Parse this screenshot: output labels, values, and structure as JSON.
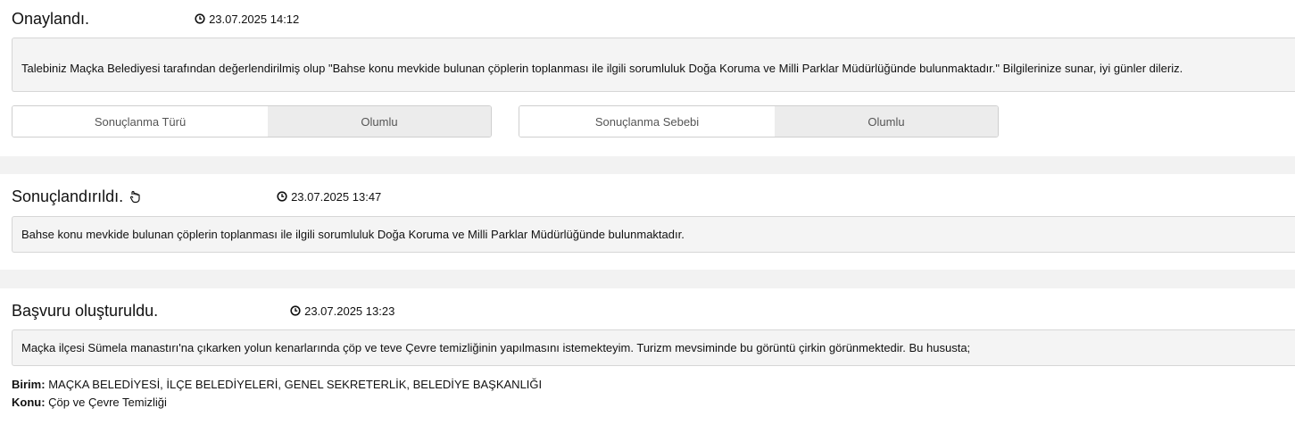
{
  "entries": [
    {
      "status": "Onaylandı.",
      "timestamp": "23.07.2025 14:12",
      "message": "Talebiniz Maçka Belediyesi tarafından değerlendirilmiş olup \"Bahse konu mevkide bulunan çöplerin toplanması ile ilgili sorumluluk Doğa Koruma ve Milli Parklar Müdürlüğünde bulunmaktadır.\" Bilgilerinize sunar, iyi günler dileriz.",
      "results": [
        {
          "label": "Sonuçlanma Türü",
          "value": "Olumlu"
        },
        {
          "label": "Sonuçlanma Sebebi",
          "value": "Olumlu"
        }
      ]
    },
    {
      "status": "Sonuçlandırıldı.",
      "timestamp": "23.07.2025 13:47",
      "message": "Bahse konu mevkide bulunan çöplerin toplanması ile ilgili sorumluluk Doğa Koruma ve Milli Parklar Müdürlüğünde bulunmaktadır."
    },
    {
      "status": "Başvuru oluşturuldu.",
      "timestamp": "23.07.2025 13:23",
      "message": "Maçka ilçesi Sümela manastırı'na çıkarken yolun kenarlarında çöp ve teve Çevre temizliğinin yapılmasını istemekteyim. Turizm mevsiminde bu görüntü çirkin görünmektedir. Bu hususta;",
      "birim_label": "Birim:",
      "birim_value": "MAÇKA BELEDİYESİ, İLÇE BELEDİYELERİ, GENEL SEKRETERLİK, BELEDİYE BAŞKANLIĞI",
      "konu_label": "Konu:",
      "konu_value": "Çöp ve Çevre Temizliği"
    }
  ],
  "icons": {
    "clock": "clock-icon",
    "hand": "hand-pointer-icon"
  }
}
